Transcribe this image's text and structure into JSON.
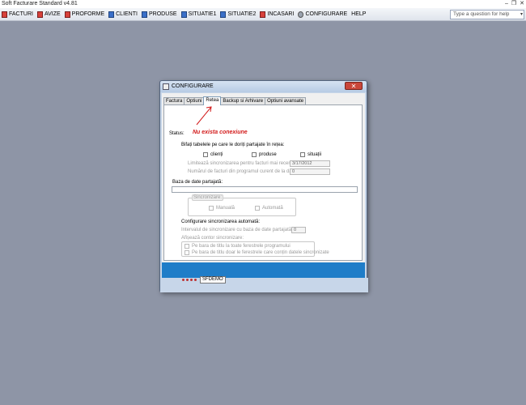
{
  "app": {
    "title": "Soft Facturare Standard v4.81",
    "controls": [
      "–",
      "❐",
      "✕"
    ]
  },
  "menu": {
    "items": [
      {
        "label": "FACTURI",
        "icon": "document-icon"
      },
      {
        "label": "AVIZE",
        "icon": "document-icon"
      },
      {
        "label": "PROFORME",
        "icon": "document-icon"
      },
      {
        "label": "CLIENTI",
        "icon": "clients-icon"
      },
      {
        "label": "PRODUSE",
        "icon": "products-icon"
      },
      {
        "label": "SITUATIE1",
        "icon": "report-icon"
      },
      {
        "label": "SITUATIE2",
        "icon": "report-icon"
      },
      {
        "label": "INCASARI",
        "icon": "payments-icon"
      },
      {
        "label": "CONFIGURARE",
        "icon": "gear-icon"
      },
      {
        "label": "HELP",
        "icon": ""
      }
    ],
    "help_placeholder": "Type a question for help"
  },
  "dialog": {
    "title": "CONFIGURARE",
    "close": "✕",
    "tabs": [
      "Factura",
      "Optiuni",
      "Retea",
      "Backup si Arhivare",
      "Optiuni avansate"
    ],
    "active_tab": "Retea",
    "status_label": "Status:",
    "status_value": "Nu exista conexiune",
    "share_label": "Bifați tabelele pe care le doriți partajate în rețea:",
    "share_checks": [
      "clienți",
      "produse",
      "situații"
    ],
    "limit_label": "Limitează sincronizarea pentru facturi mai recente de:",
    "limit_date": "3/17/2012",
    "count_label": "Numărul de facturi din programul curent de la data aleasă:",
    "count_value": "0",
    "db_label": "Baza de date partajată:",
    "sync_legend": "Sincronizare:",
    "sync_options": [
      "Manuală",
      "Automată"
    ],
    "auto_label": "Configurare sincronizarea automată:",
    "interval_label": "Intervalul de sincronizare cu baza de date partajată (sec.):",
    "interval_value": "0",
    "counter_legend": "Afișează contor sincronizare:",
    "counter_options": [
      "Pe bara de titlu la toate ferestrele programului",
      "Pe bara de titlu doar le ferestrele care conțin datele sincronizate"
    ],
    "db_name": "SFDEMO"
  },
  "colors": {
    "desktop": "#8e95a6",
    "status_red": "#d21a1a",
    "band_blue": "#1f7dc8"
  }
}
